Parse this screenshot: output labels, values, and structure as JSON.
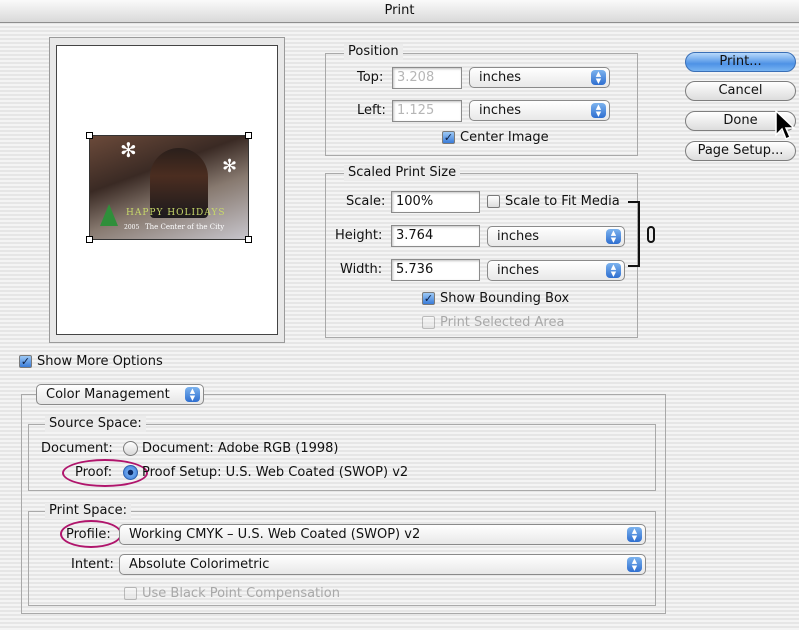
{
  "window": {
    "title": "Print"
  },
  "buttons": {
    "print": "Print...",
    "cancel": "Cancel",
    "done": "Done",
    "page_setup": "Page Setup..."
  },
  "position": {
    "legend": "Position",
    "top_label": "Top:",
    "top_value": "3.208",
    "top_unit": "inches",
    "left_label": "Left:",
    "left_value": "1.125",
    "left_unit": "inches",
    "center_image_label": "Center Image"
  },
  "scaled": {
    "legend": "Scaled Print Size",
    "scale_label": "Scale:",
    "scale_value": "100%",
    "scale_to_fit_label": "Scale to Fit Media",
    "height_label": "Height:",
    "height_value": "3.764",
    "height_unit": "inches",
    "width_label": "Width:",
    "width_value": "5.736",
    "width_unit": "inches",
    "show_bounding_box_label": "Show Bounding Box",
    "print_selected_area_label": "Print Selected Area"
  },
  "preview": {
    "image_caption_title": "HAPPY HOLIDAYS",
    "image_caption_subtitle": "The Center of the City",
    "image_caption_year": "2005"
  },
  "show_more_options_label": "Show More Options",
  "options_popup": "Color Management",
  "source_space": {
    "legend": "Source Space:",
    "document_label": "Document:",
    "document_option": "Document:  Adobe RGB (1998)",
    "proof_label": "Proof:",
    "proof_option": "Proof Setup:  U.S. Web Coated (SWOP) v2"
  },
  "print_space": {
    "legend": "Print Space:",
    "profile_label": "Profile:",
    "profile_value": "Working CMYK – U.S. Web Coated (SWOP) v2",
    "intent_label": "Intent:",
    "intent_value": "Absolute Colorimetric",
    "bpc_label": "Use Black Point Compensation"
  },
  "colors": {
    "highlight_ring": "#b0156c",
    "default_button": "#4e92e6"
  }
}
